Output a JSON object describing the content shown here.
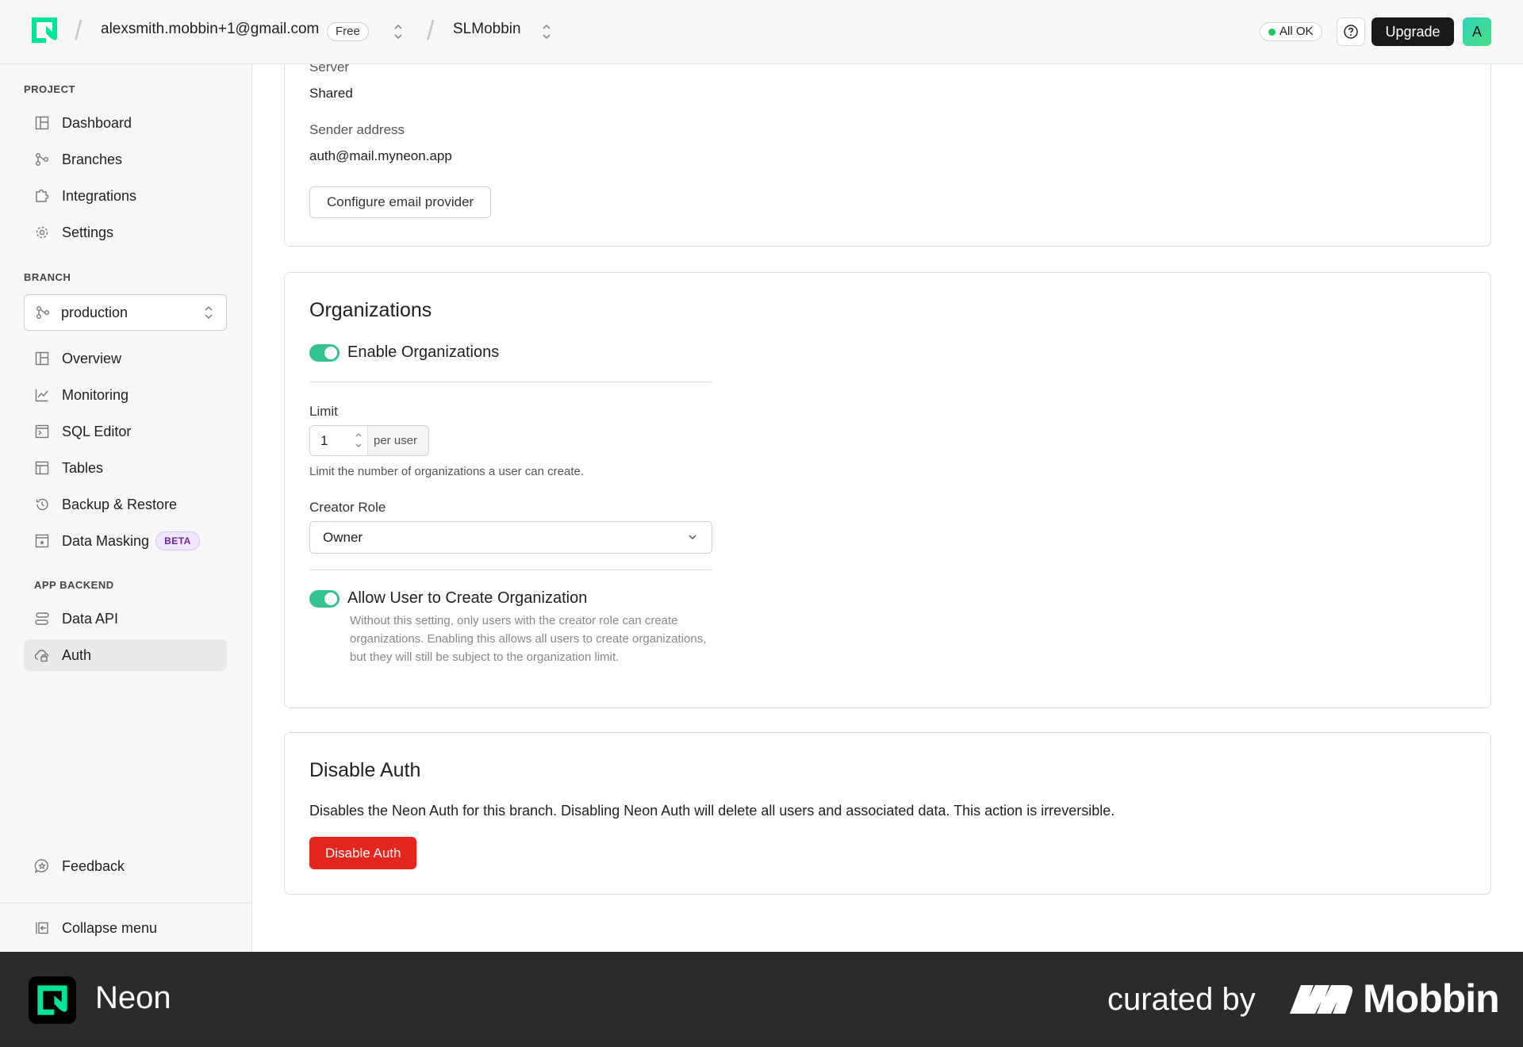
{
  "topbar": {
    "email": "alexsmith.mobbin+1@gmail.com",
    "plan_badge": "Free",
    "project": "SLMobbin",
    "status": "All OK",
    "upgrade_label": "Upgrade",
    "avatar_initial": "A"
  },
  "sidebar": {
    "project_section": "PROJECT",
    "project_items": [
      {
        "label": "Dashboard",
        "icon": "dashboard-icon"
      },
      {
        "label": "Branches",
        "icon": "branches-icon"
      },
      {
        "label": "Integrations",
        "icon": "puzzle-icon"
      },
      {
        "label": "Settings",
        "icon": "gear-icon"
      }
    ],
    "branch_section": "BRANCH",
    "branch_selected": "production",
    "branch_items": [
      {
        "label": "Overview",
        "icon": "dashboard-icon"
      },
      {
        "label": "Monitoring",
        "icon": "chart-icon"
      },
      {
        "label": "SQL Editor",
        "icon": "terminal-icon"
      },
      {
        "label": "Tables",
        "icon": "table-icon"
      },
      {
        "label": "Backup & Restore",
        "icon": "history-icon"
      },
      {
        "label": "Data Masking",
        "icon": "mask-icon",
        "badge": "BETA"
      }
    ],
    "app_backend_section": "APP BACKEND",
    "app_backend_items": [
      {
        "label": "Data API",
        "icon": "api-icon"
      },
      {
        "label": "Auth",
        "icon": "cloud-lock-icon",
        "active": true
      }
    ],
    "feedback_label": "Feedback",
    "collapse_label": "Collapse menu"
  },
  "email_card": {
    "server_label": "Server",
    "server_value": "Shared",
    "sender_label": "Sender address",
    "sender_value": "auth@mail.myneon.app",
    "configure_button": "Configure email provider"
  },
  "organizations_card": {
    "title": "Organizations",
    "enable_label": "Enable Organizations",
    "enable_on": true,
    "limit_label": "Limit",
    "limit_value": "1",
    "limit_unit": "per user",
    "limit_help": "Limit the number of organizations a user can create.",
    "creator_role_label": "Creator Role",
    "creator_role_value": "Owner",
    "allow_label": "Allow User to Create Organization",
    "allow_on": true,
    "allow_help": "Without this setting, only users with the creator role can create organizations. Enabling this allows all users to create organizations, but they will still be subject to the organization limit."
  },
  "disable_card": {
    "title": "Disable Auth",
    "description": "Disables the Neon Auth for this branch. Disabling Neon Auth will delete all users and associated data. This action is irreversible.",
    "button": "Disable Auth"
  },
  "footer": {
    "brand": "Neon",
    "curated_by": "curated by",
    "mobbin": "Mobbin"
  },
  "colors": {
    "accent_green": "#34c38f",
    "danger": "#e5261f",
    "neon_brand": "#00e599"
  }
}
